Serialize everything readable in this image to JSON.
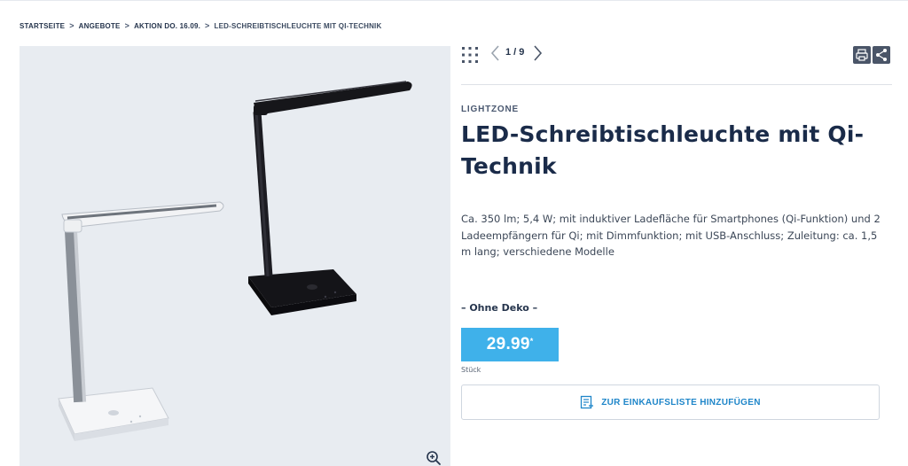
{
  "breadcrumb": [
    {
      "label": "STARTSEITE"
    },
    {
      "label": "ANGEBOTE"
    },
    {
      "label": "AKTION DO. 16.09."
    },
    {
      "label": "LED-SCHREIBTISCHLEUCHTE MIT QI-TECHNIK"
    }
  ],
  "gallery": {
    "counter": "1 / 9"
  },
  "product": {
    "brand": "LIGHTZONE",
    "title": "LED-Schreibtischleuchte mit Qi-Technik",
    "description": "Ca. 350 lm; 5,4 W; mit induktiver Ladefläche für Smartphones (Qi-Funktion) und 2 Ladeempfängern für Qi; mit Dimmfunktion; mit USB-Anschluss; Zuleitung: ca. 1,5 m lang; verschiedene Modelle",
    "variant": "– Ohne Deko –",
    "price": "29.99",
    "price_mark": "*",
    "unit": "Stück",
    "add_to_list_label": "ZUR EINKAUFSLISTE HINZUFÜGEN"
  },
  "icons": {
    "grid": "grid-icon",
    "prev": "chevron-left-icon",
    "next": "chevron-right-icon",
    "print": "print-icon",
    "share": "share-icon",
    "zoom": "zoom-in-icon",
    "list": "shopping-list-icon"
  },
  "colors": {
    "price_bg": "#3fb1ea",
    "title": "#1a2b49",
    "button_text": "#1f86c9",
    "image_bg": "#e8ecf1"
  }
}
